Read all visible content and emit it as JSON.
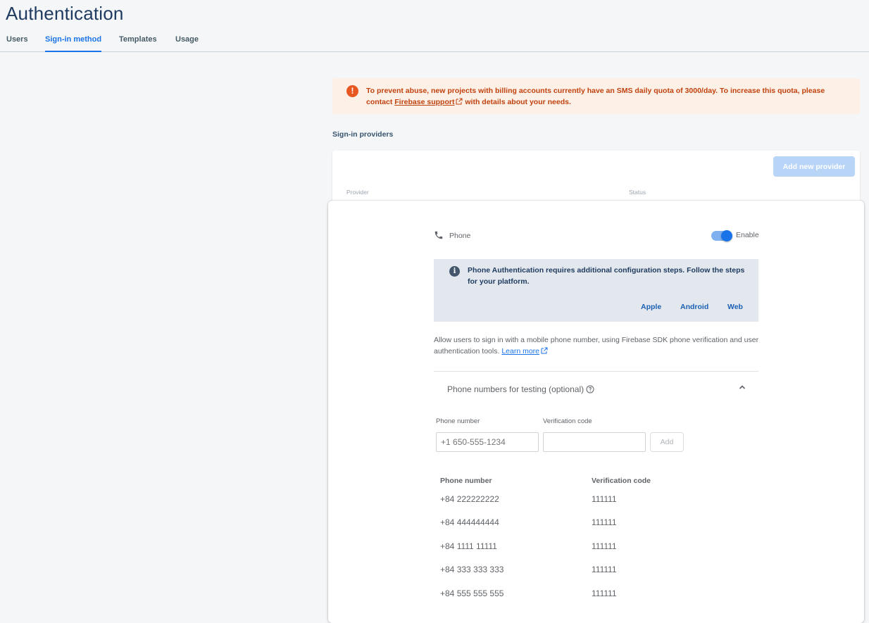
{
  "header": {
    "title": "Authentication",
    "tabs": [
      {
        "label": "Users"
      },
      {
        "label": "Sign-in method"
      },
      {
        "label": "Templates"
      },
      {
        "label": "Usage"
      }
    ]
  },
  "warning": {
    "text_before": "To prevent abuse, new projects with billing accounts currently have an SMS daily quota of 3000/day. To increase this quota, please contact ",
    "link_label": "Firebase support",
    "text_after": " with details about your needs."
  },
  "providers": {
    "section_label": "Sign-in providers",
    "add_button_label": "Add new provider",
    "col_provider": "Provider",
    "col_status": "Status"
  },
  "phone_panel": {
    "provider_label": "Phone",
    "enabled": true,
    "enable_label": "Enable",
    "info_text": "Phone Authentication requires additional configuration steps. Follow the steps for your platform.",
    "platform_links": [
      "Apple",
      "Android",
      "Web"
    ],
    "description": "Allow users to sign in with a mobile phone number, using Firebase SDK phone verification and user authentication tools. ",
    "learn_more_label": "Learn more",
    "testing_title": "Phone numbers for testing (optional)",
    "phone_field_label": "Phone number",
    "phone_field_placeholder": "+1 650-555-1234",
    "code_field_label": "Verification code",
    "code_field_placeholder": "",
    "add_button_label": "Add",
    "table_headers": {
      "phone": "Phone number",
      "code": "Verification code"
    },
    "test_numbers": [
      {
        "phone": "+84 222222222",
        "code": "111111"
      },
      {
        "phone": "+84 444444444",
        "code": "111111"
      },
      {
        "phone": "+84 1111 11111",
        "code": "111111"
      },
      {
        "phone": "+84 333 333 333",
        "code": "111111"
      },
      {
        "phone": "+84 555 555 555",
        "code": "111111"
      }
    ]
  },
  "colors": {
    "accent": "#1a73e8",
    "warning_bg": "#fdf0e6",
    "warning_text": "#c0420f",
    "info_bg": "#e3e8ee"
  },
  "icons": [
    "error-icon",
    "external-link-icon",
    "phone-icon",
    "info-icon",
    "help-icon",
    "chevron-up-icon"
  ]
}
